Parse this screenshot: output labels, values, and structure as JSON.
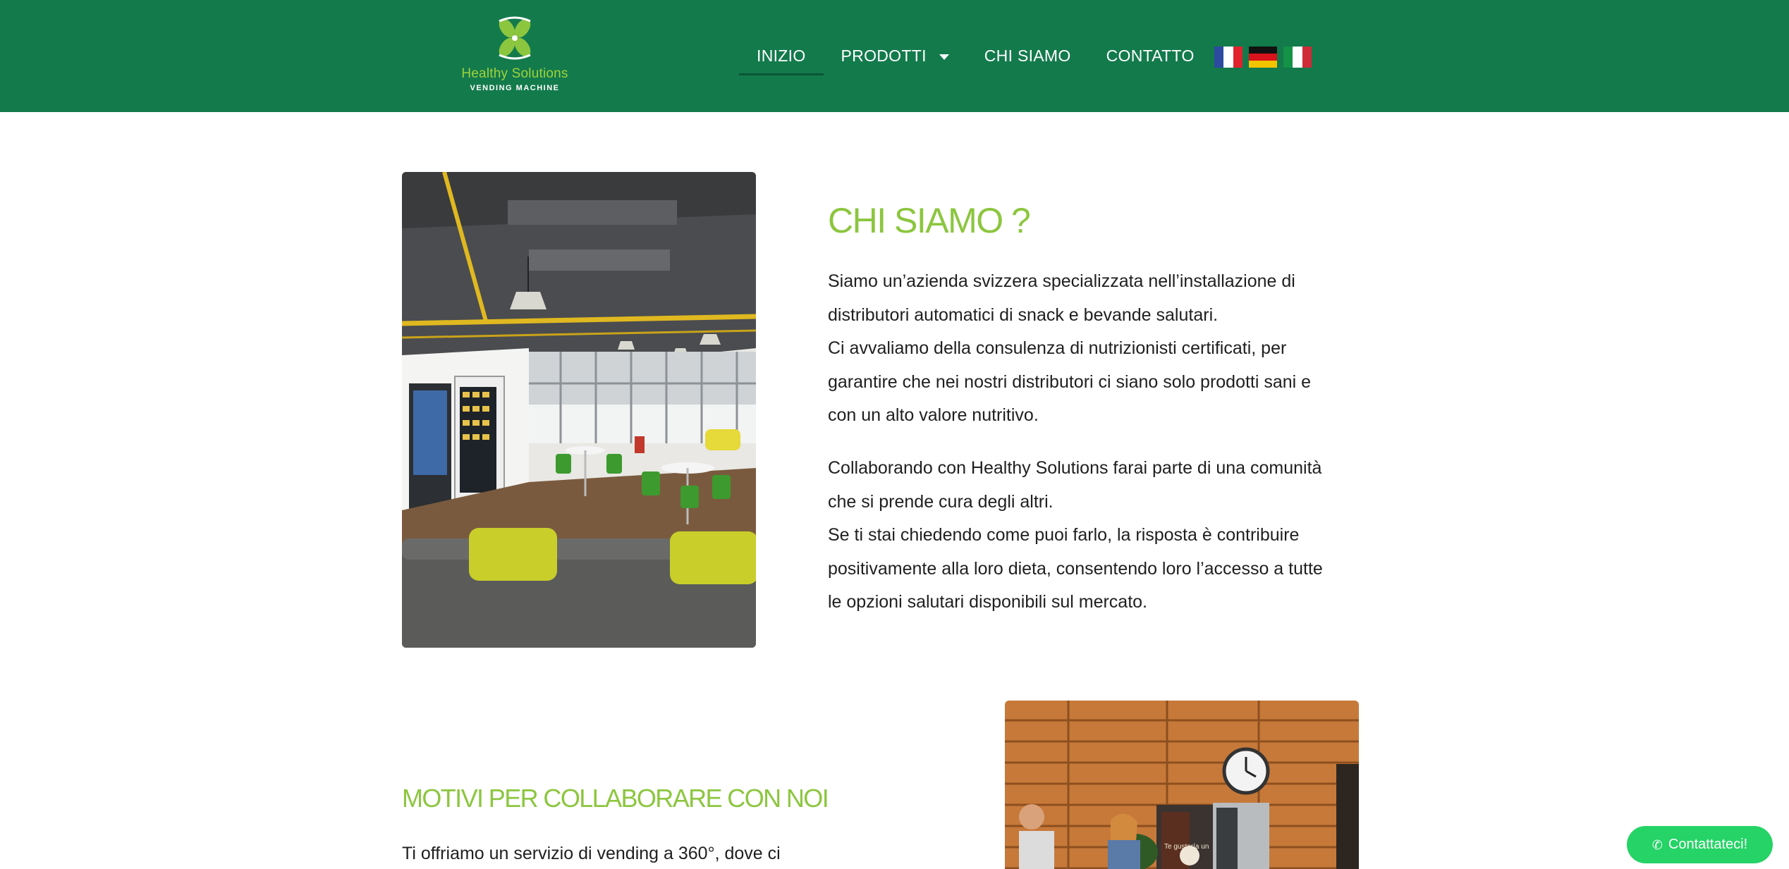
{
  "colors": {
    "header_bg": "#137a4c",
    "accent_green": "#8cc63f",
    "whatsapp_green": "#25d366"
  },
  "brand": {
    "name": "Healthy Solutions",
    "subtitle": "VENDING MACHINE"
  },
  "nav": {
    "items": [
      {
        "label": "INIZIO",
        "active": true
      },
      {
        "label": "PRODOTTI",
        "has_dropdown": true
      },
      {
        "label": "CHI SIAMO"
      },
      {
        "label": "CONTATTO"
      }
    ],
    "languages": [
      {
        "name": "french-flag-icon",
        "colors": [
          "#2b4aa0",
          "#ffffff",
          "#e0232e"
        ]
      },
      {
        "name": "german-flag-icon",
        "colors": [
          "#111111",
          "#d8131b",
          "#f3c400"
        ]
      },
      {
        "name": "italian-flag-icon",
        "colors": [
          "#149246",
          "#ffffff",
          "#ce2b37"
        ]
      }
    ]
  },
  "about": {
    "title": "CHI SIAMO ?",
    "paragraph1": "Siamo un’azienda svizzera specializzata nell’installazione di distributori automatici di snack e bevande salutari.\nCi avvaliamo della consulenza di nutrizionisti certificati, per garantire che nei nostri distributori ci siano solo prodotti sani e con un alto valore nutritivo.",
    "paragraph2": "Collaborando con Healthy Solutions farai parte di una comunità che si prende cura degli altri.\nSe ti stai chiedendo come puoi farlo, la risposta è contribuire positivamente alla loro dieta, consentendo loro l’accesso a tutte le opzioni salutari disponibili sul mercato."
  },
  "motivi": {
    "title": "MOTIVI PER COLLABORARE CON NOI",
    "text": "Ti offriamo un servizio di vending a 360°, dove ci"
  },
  "photo2": {
    "machine_text": "Te gustaría un"
  },
  "whatsapp": {
    "icon": "whatsapp-icon",
    "label": "Contattateci!"
  }
}
